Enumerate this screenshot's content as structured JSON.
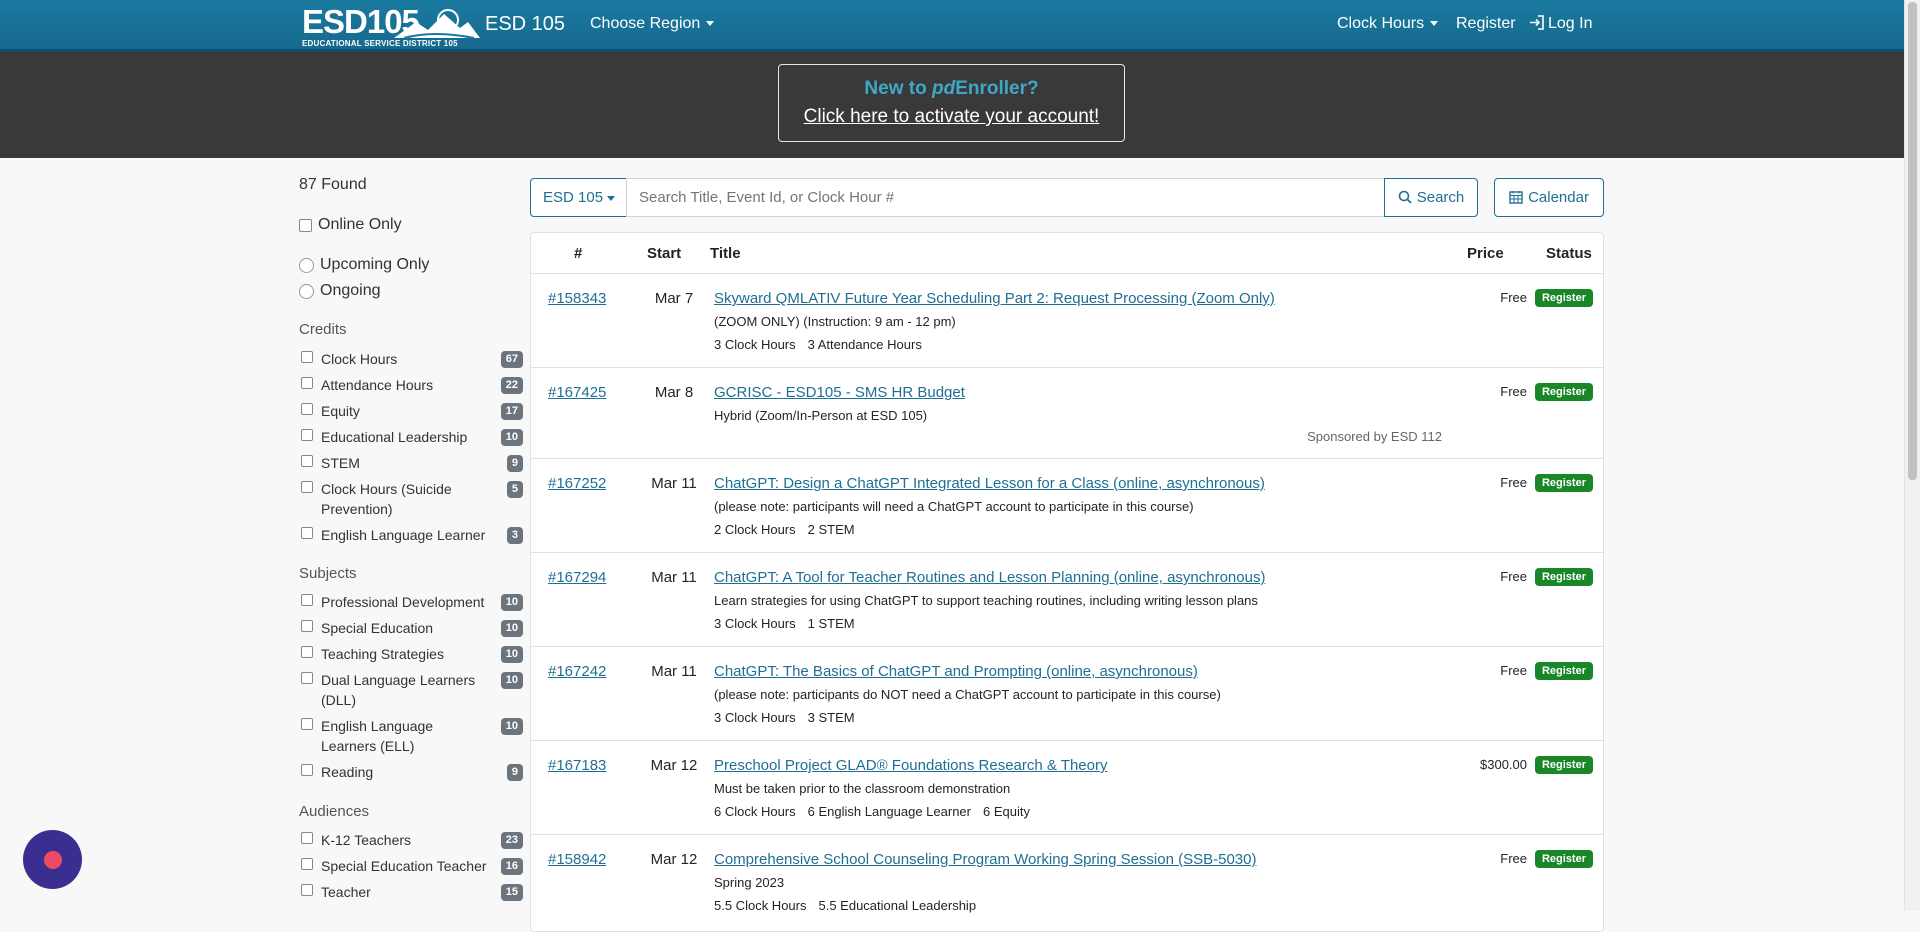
{
  "navbar": {
    "logo_text": "ESD105",
    "logo_subtext": "EDUCATIONAL SERVICE DISTRICT 105",
    "brand": "ESD 105",
    "choose_region": "Choose Region",
    "clock_hours": "Clock Hours",
    "register": "Register",
    "login": "Log In"
  },
  "banner": {
    "line1_prefix": "New to ",
    "line1_em": "pd",
    "line1_suffix": "Enroller?",
    "line2": "Click here to activate your account!"
  },
  "sidebar": {
    "found": "87 Found",
    "online_only": "Online Only",
    "upcoming_only": "Upcoming Only",
    "ongoing": "Ongoing",
    "credits_header": "Credits",
    "credits": [
      {
        "label": "Clock Hours",
        "count": "67"
      },
      {
        "label": "Attendance Hours",
        "count": "22"
      },
      {
        "label": "Equity",
        "count": "17"
      },
      {
        "label": "Educational Leadership",
        "count": "10"
      },
      {
        "label": "STEM",
        "count": "9"
      },
      {
        "label": "Clock Hours (Suicide Prevention)",
        "count": "5"
      },
      {
        "label": "English Language Learner",
        "count": "3"
      }
    ],
    "subjects_header": "Subjects",
    "subjects": [
      {
        "label": "Professional Development",
        "count": "10"
      },
      {
        "label": "Special Education",
        "count": "10"
      },
      {
        "label": "Teaching Strategies",
        "count": "10"
      },
      {
        "label": "Dual Language Learners (DLL)",
        "count": "10"
      },
      {
        "label": "English Language Learners (ELL)",
        "count": "10"
      },
      {
        "label": "Reading",
        "count": "9"
      }
    ],
    "audiences_header": "Audiences",
    "audiences": [
      {
        "label": "K-12 Teachers",
        "count": "23"
      },
      {
        "label": "Special Education Teacher",
        "count": "16"
      },
      {
        "label": "Teacher",
        "count": "15"
      }
    ]
  },
  "search": {
    "region": "ESD 105",
    "placeholder": "Search Title, Event Id, or Clock Hour #",
    "button": "Search",
    "calendar": "Calendar"
  },
  "table": {
    "headers": {
      "num": "#",
      "start": "Start",
      "title": "Title",
      "price": "Price",
      "status": "Status"
    },
    "rows": [
      {
        "num": "#158343",
        "start": "Mar 7",
        "title": "Skyward QMLATIV Future Year Scheduling Part 2: Request Processing (Zoom Only)",
        "desc": "(ZOOM ONLY) (Instruction: 9 am - 12 pm)",
        "credits": [
          "3 Clock Hours",
          "3 Attendance Hours"
        ],
        "sponsor": "",
        "price": "Free",
        "status": "Register"
      },
      {
        "num": "#167425",
        "start": "Mar 8",
        "title": "GCRISC - ESD105 - SMS HR Budget",
        "desc": "Hybrid (Zoom/In-Person at ESD 105)",
        "credits": [],
        "sponsor": "Sponsored by ESD 112",
        "price": "Free",
        "status": "Register"
      },
      {
        "num": "#167252",
        "start": "Mar 11",
        "title": "ChatGPT: Design a ChatGPT Integrated Lesson for a Class (online, asynchronous)",
        "desc": "(please note: participants will need a ChatGPT account to participate in this course)",
        "credits": [
          "2 Clock Hours",
          "2 STEM"
        ],
        "sponsor": "",
        "price": "Free",
        "status": "Register"
      },
      {
        "num": "#167294",
        "start": "Mar 11",
        "title": "ChatGPT: A Tool for Teacher Routines and Lesson Planning (online, asynchronous)",
        "desc": "Learn strategies for using ChatGPT to support teaching routines, including writing lesson plans",
        "credits": [
          "3 Clock Hours",
          "1 STEM"
        ],
        "sponsor": "",
        "price": "Free",
        "status": "Register"
      },
      {
        "num": "#167242",
        "start": "Mar 11",
        "title": "ChatGPT: The Basics of ChatGPT and Prompting (online, asynchronous)",
        "desc": "(please note: participants do NOT need a ChatGPT account to participate in this course)",
        "credits": [
          "3 Clock Hours",
          "3 STEM"
        ],
        "sponsor": "",
        "price": "Free",
        "status": "Register"
      },
      {
        "num": "#167183",
        "start": "Mar 12",
        "title": "Preschool Project GLAD® Foundations Research & Theory",
        "desc": "Must be taken prior to the classroom demonstration",
        "credits": [
          "6 Clock Hours",
          "6 English Language Learner",
          "6 Equity"
        ],
        "sponsor": "",
        "price": "$300.00",
        "status": "Register"
      },
      {
        "num": "#158942",
        "start": "Mar 12",
        "title": "Comprehensive School Counseling Program Working Spring Session (SSB-5030)",
        "desc": "Spring 2023",
        "credits": [
          "5.5 Clock Hours",
          "5.5 Educational Leadership"
        ],
        "sponsor": "",
        "price": "Free",
        "status": "Register"
      }
    ]
  },
  "colors": {
    "nav": "#1b7aa1",
    "banner": "#393939",
    "link": "#1f6f93",
    "register": "#198727",
    "badge": "#6c757d"
  }
}
